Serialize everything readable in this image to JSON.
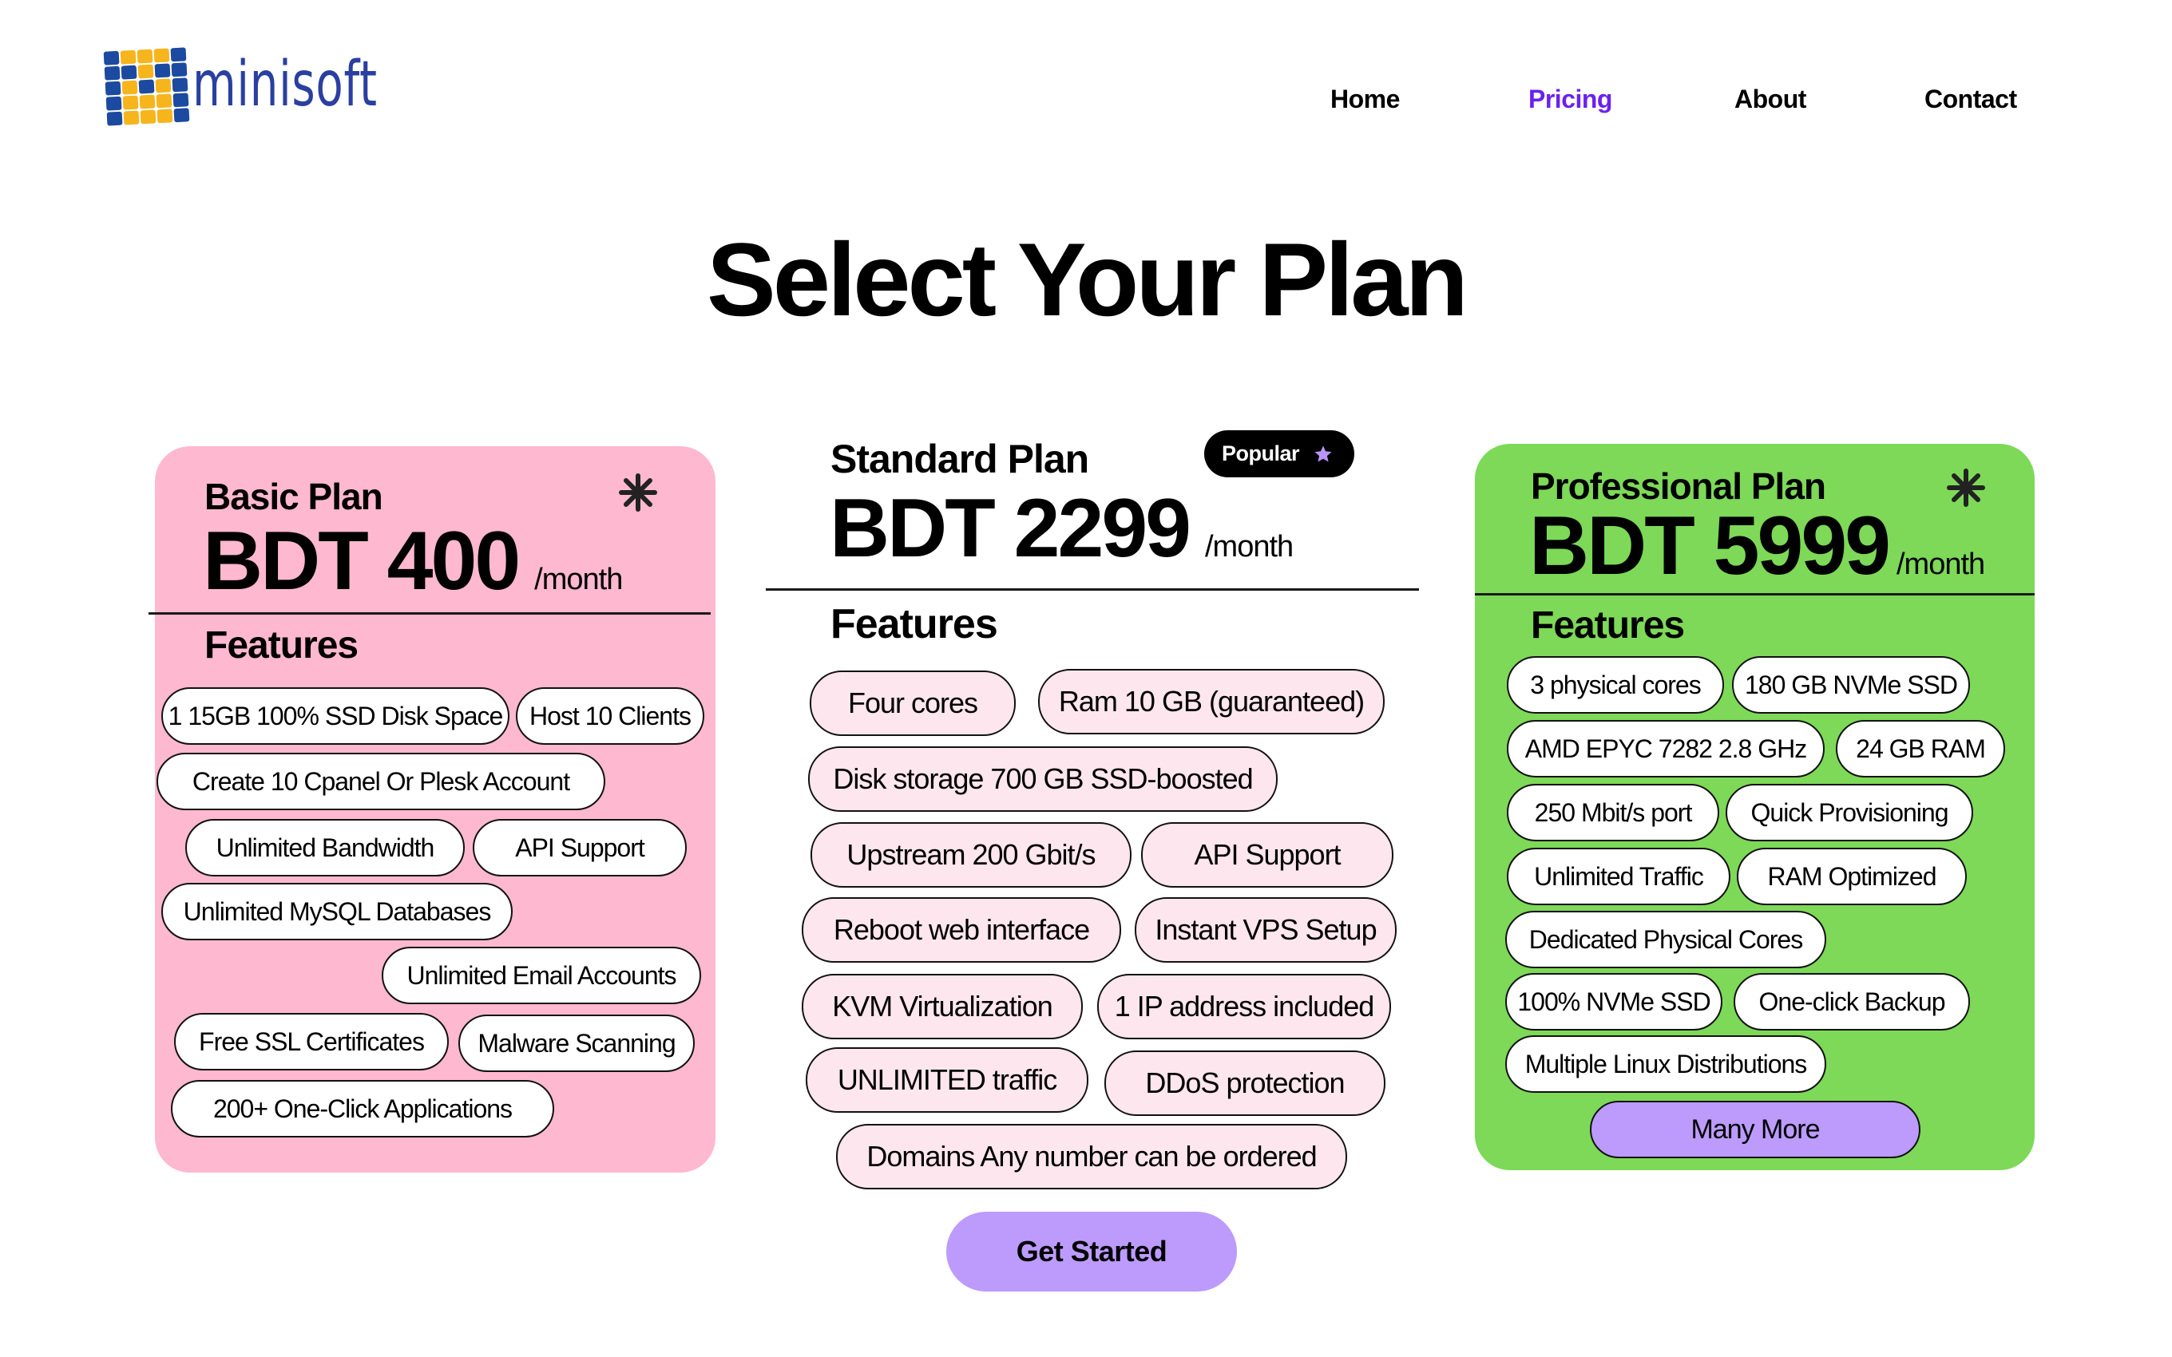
{
  "brand": {
    "name": "minisoft",
    "colors": {
      "blue": "#1c4aa0",
      "yellow": "#f6b51c"
    }
  },
  "nav": {
    "items": [
      {
        "label": "Home",
        "active": false
      },
      {
        "label": "Pricing",
        "active": true
      },
      {
        "label": "About",
        "active": false
      },
      {
        "label": "Contact",
        "active": false
      }
    ],
    "active_color": "#6a22ee"
  },
  "page": {
    "title": "Select Your Plan"
  },
  "plans": [
    {
      "id": "basic",
      "name": "Basic Plan",
      "price": "BDT 400",
      "period": "/month",
      "features_title": "Features",
      "icon": "asterisk-icon",
      "background": "#feb8d0",
      "features": [
        "1 15GB 100% SSD Disk Space",
        "Host 10 Clients",
        "Create 10 Cpanel Or Plesk Account",
        "Unlimited Bandwidth",
        "API Support",
        "Unlimited MySQL Databases",
        "Unlimited Email Accounts",
        "Free SSL Certificates",
        "Malware Scanning",
        "200+ One-Click Applications"
      ]
    },
    {
      "id": "standard",
      "name": "Standard Plan",
      "badge": "Popular",
      "badge_icon": "star-icon",
      "price": "BDT 2299",
      "period": "/month",
      "features_title": "Features",
      "chip_background": "#fde6ee",
      "features": [
        "Four cores",
        "Ram 10 GB (guaranteed)",
        "Disk storage 700 GB SSD-boosted",
        "Upstream 200 Gbit/s",
        "API Support",
        "Reboot web interface",
        "Instant VPS Setup",
        "KVM Virtualization",
        "1 IP address included",
        "UNLIMITED traffic",
        "DDoS protection",
        "Domains Any number can be ordered"
      ],
      "cta": "Get Started",
      "cta_color": "#bc9bfd"
    },
    {
      "id": "professional",
      "name": "Professional Plan",
      "price": "BDT 5999",
      "period": "/month",
      "features_title": "Features",
      "icon": "asterisk-icon",
      "background": "#7dd957",
      "features": [
        "3 physical cores",
        "180 GB NVMe SSD",
        "AMD EPYC 7282 2.8 GHz",
        "24 GB RAM",
        "250 Mbit/s port",
        "Quick Provisioning",
        "Unlimited Traffic",
        "RAM Optimized",
        "Dedicated Physical Cores",
        "100% NVMe SSD",
        "One-click Backup",
        "Multiple Linux Distributions"
      ],
      "more_button": "Many More"
    }
  ]
}
